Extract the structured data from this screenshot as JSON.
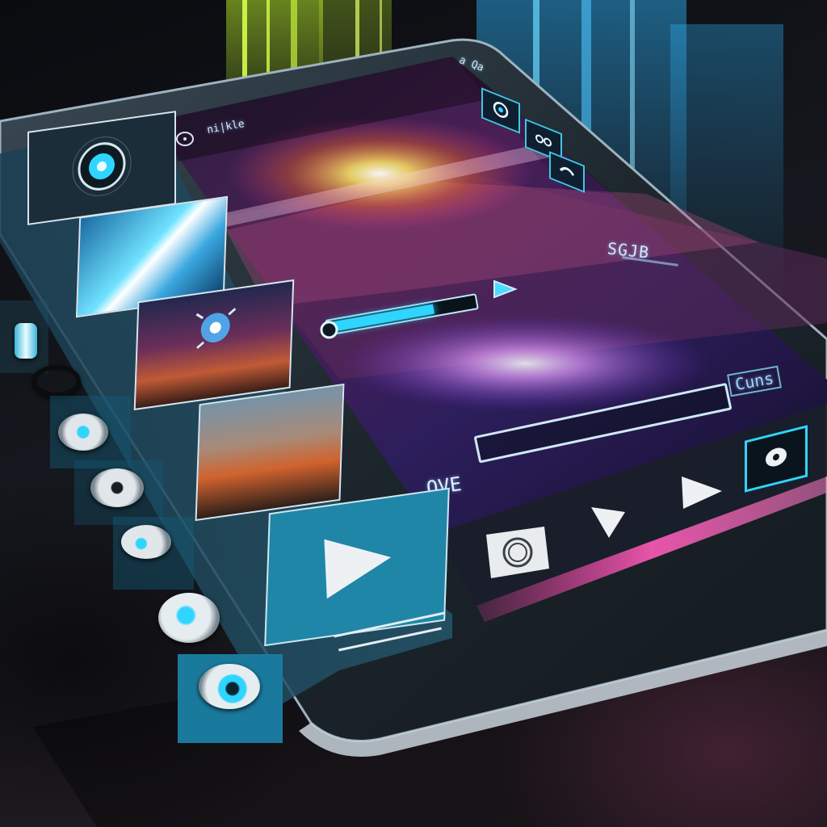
{
  "header": {
    "app_label": "ni|kle",
    "top_code": "a Qa"
  },
  "player": {
    "time_readout": "SGJB",
    "duration_label": "Cuns",
    "status_label": "OVE"
  },
  "colors": {
    "accent": "#2fd5ff",
    "panel": "#1e4a5e",
    "neon_pink": "#ff3fa8",
    "neon_green": "#b6e82a"
  },
  "progress": {
    "primary_fraction": 0.72,
    "secondary_fraction": 0.0
  },
  "icons": {
    "top_icons": [
      "circle-record-icon",
      "two-dot-icon",
      "chevron-icon"
    ],
    "side_buttons": [
      "screw-icon",
      "ring-icon",
      "dial-icon",
      "dial-icon",
      "speaker-icon",
      "glow-dial-icon",
      "power-icon"
    ],
    "bottom_icons": [
      "camera-icon",
      "diamond-icon",
      "play-icon",
      "target-icon"
    ]
  }
}
